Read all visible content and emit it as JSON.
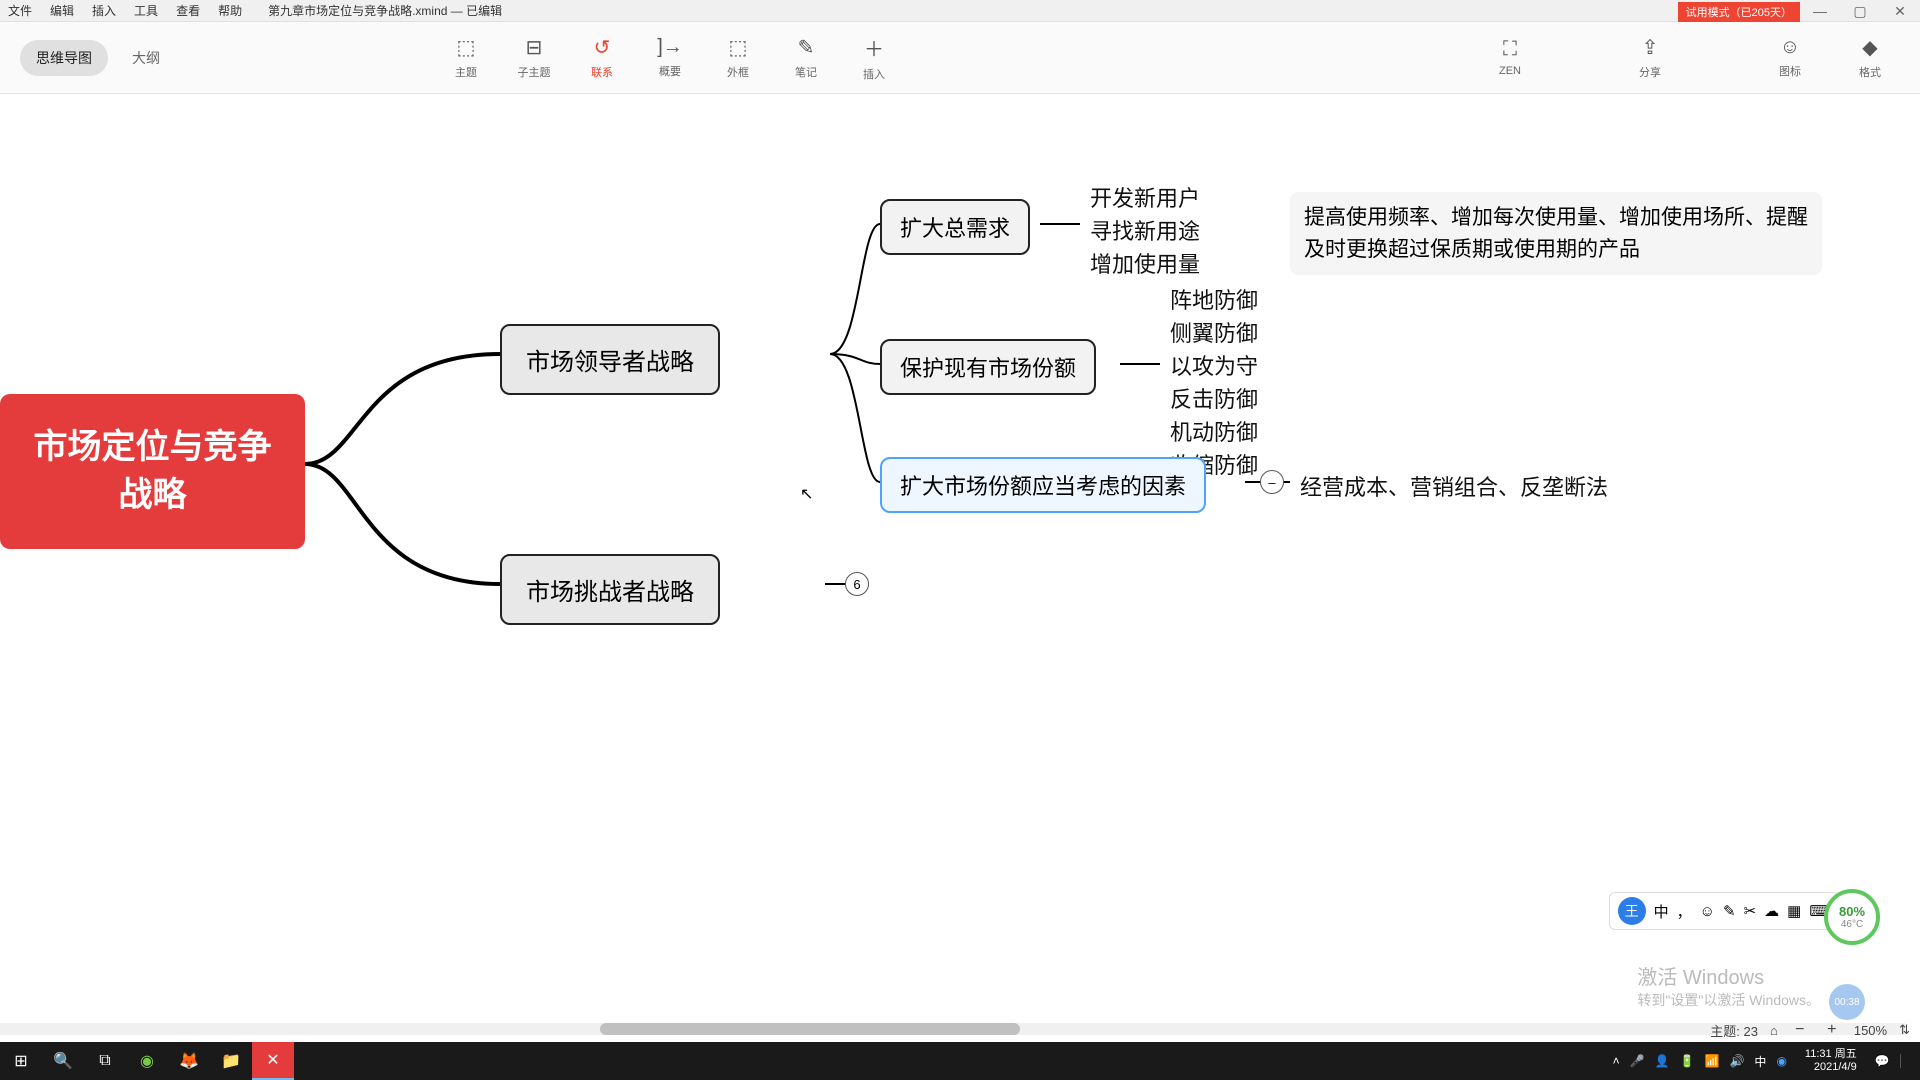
{
  "menu": {
    "file": "文件",
    "edit": "编辑",
    "insert": "插入",
    "tools": "工具",
    "view": "查看",
    "help": "帮助"
  },
  "document": {
    "name": "第九章市场定位与竞争战略.xmind",
    "status": "— 已编辑"
  },
  "trial": "试用模式（已205天）",
  "view_tabs": {
    "mindmap": "思维导图",
    "outline": "大纲"
  },
  "tools": {
    "topic": "主题",
    "subtopic": "子主题",
    "relation": "联系",
    "summary": "概要",
    "boundary": "外框",
    "note": "笔记",
    "insert": "插入",
    "zen": "ZEN",
    "share": "分享",
    "icon": "图标",
    "format": "格式"
  },
  "mindmap": {
    "root": "市场定位与竞争\n战略",
    "branch1": {
      "title": "市场领导者战略",
      "n1": {
        "title": "扩大总需求",
        "children": [
          "开发新用户",
          "寻找新用途",
          "增加使用量"
        ],
        "detail": "提高使用频率、增加每次使用量、增加使用场所、提醒\n及时更换超过保质期或使用期的产品"
      },
      "n2": {
        "title": "保护现有市场份额",
        "children": [
          "阵地防御",
          "侧翼防御",
          "以攻为守",
          "反击防御",
          "机动防御",
          "收缩防御"
        ]
      },
      "n3": {
        "title": "扩大市场份额应当考虑的因素",
        "detail": "经营成本、营销组合、反垄断法"
      }
    },
    "branch2": {
      "title": "市场挑战者战略",
      "collapsed_count": "6"
    }
  },
  "watermark": {
    "line1": "激活 Windows",
    "line2": "转到\"设置\"以激活 Windows。"
  },
  "status": {
    "topics_label": "主题:",
    "topics_count": "23",
    "zoom": "150%"
  },
  "perf": {
    "pct": "80%",
    "temp": "46°C"
  },
  "timer": "00:38",
  "ime": {
    "items": [
      "中",
      "，",
      "☺",
      "✎",
      "✂",
      "☁",
      "▦",
      "⌨"
    ]
  },
  "taskbar": {
    "time": "11:31",
    "day": "周五",
    "date": "2021/4/9",
    "ime": "中"
  }
}
